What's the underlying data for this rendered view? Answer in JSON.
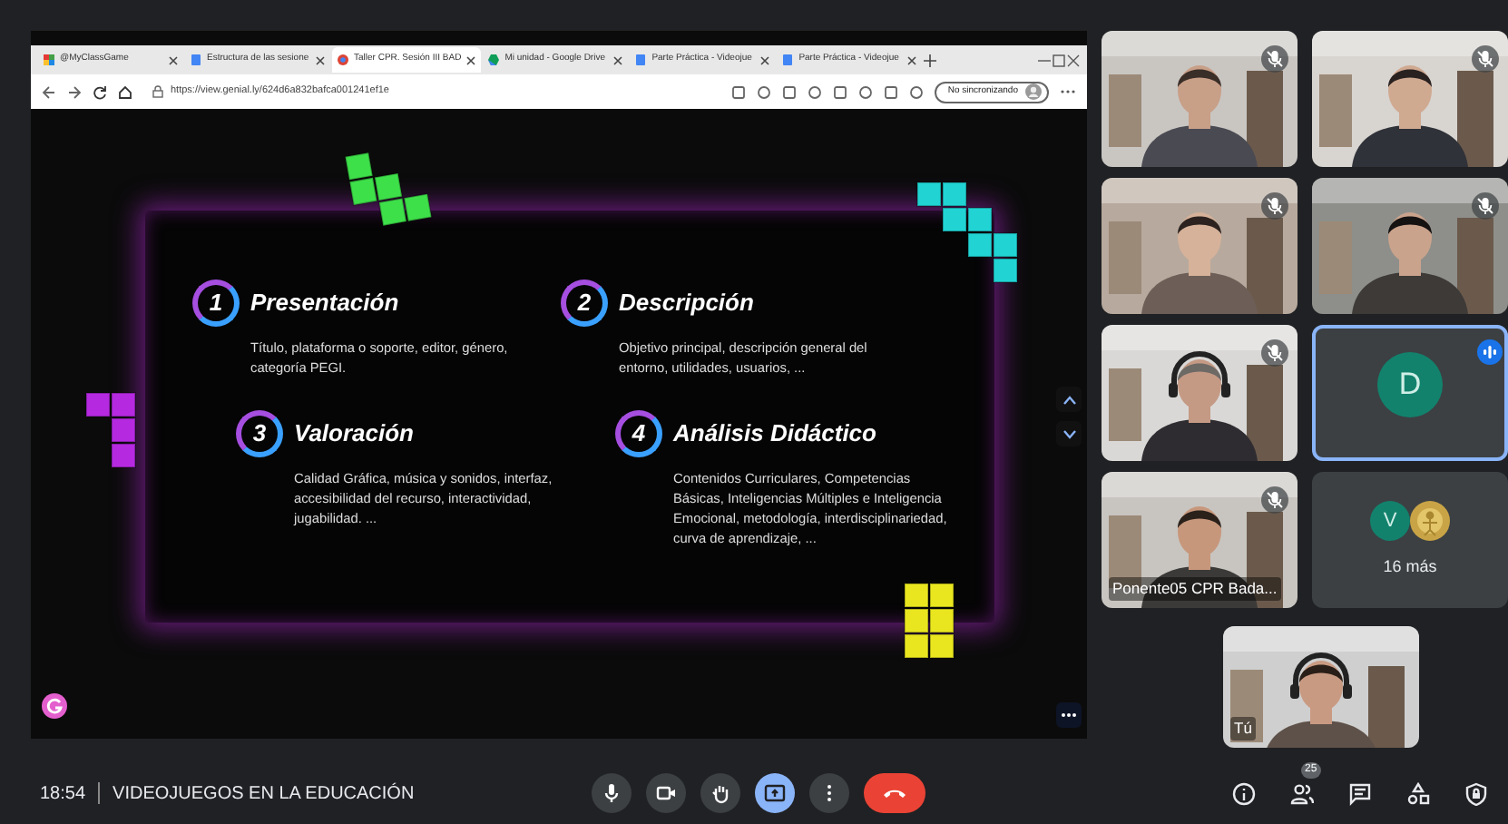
{
  "browser": {
    "tabs": [
      {
        "label": "@MyClassGame",
        "kind": "game",
        "selected": false
      },
      {
        "label": "Estructura de las sesione",
        "kind": "doc",
        "selected": false
      },
      {
        "label": "Taller CPR. Sesión III BAD",
        "kind": "circle",
        "selected": true
      },
      {
        "label": "Mi unidad - Google Drive",
        "kind": "drive",
        "selected": false
      },
      {
        "label": "Parte Práctica - Videojue",
        "kind": "doc",
        "selected": false
      },
      {
        "label": "Parte Práctica - Videojue",
        "kind": "doc",
        "selected": false
      }
    ],
    "address": "https://view.genial.ly/624d6a832bafca001241ef1e",
    "sync_button": "No sincronizando"
  },
  "slide": {
    "sections": [
      {
        "number": "1",
        "title": "Presentación",
        "text": "Título, plataforma o soporte, editor, género, categoría PEGI."
      },
      {
        "number": "2",
        "title": "Descripción",
        "text": "Objetivo principal, descripción general del entorno, utilidades, usuarios, ..."
      },
      {
        "number": "3",
        "title": "Valoración",
        "text": "Calidad Gráfica, música y sonidos, interfaz, accesibilidad del recurso, interactividad, jugabilidad. ..."
      },
      {
        "number": "4",
        "title": "Análisis Didáctico",
        "text": "Contenidos Curriculares, Competencias Básicas, Inteligencias Múltiples e Inteligencia Emocional, metodología, interdisciplinariedad, curva de aprendizaje, ..."
      }
    ]
  },
  "participants": [
    {
      "kind": "video",
      "muted": true
    },
    {
      "kind": "video",
      "muted": true
    },
    {
      "kind": "video",
      "muted": true
    },
    {
      "kind": "video",
      "muted": true
    },
    {
      "kind": "video",
      "muted": true
    },
    {
      "kind": "avatar",
      "initial": "D",
      "speaking": true
    },
    {
      "kind": "video",
      "muted": true,
      "name": "Ponente05 CPR Bada..."
    },
    {
      "kind": "more",
      "initial": "V",
      "label": "16 más"
    }
  ],
  "self_view": {
    "label": "Tú"
  },
  "meeting": {
    "time": "18:54",
    "title": "VIDEOJUEGOS EN LA EDUCACIÓN",
    "participants_badge": "25",
    "presenting": true
  }
}
